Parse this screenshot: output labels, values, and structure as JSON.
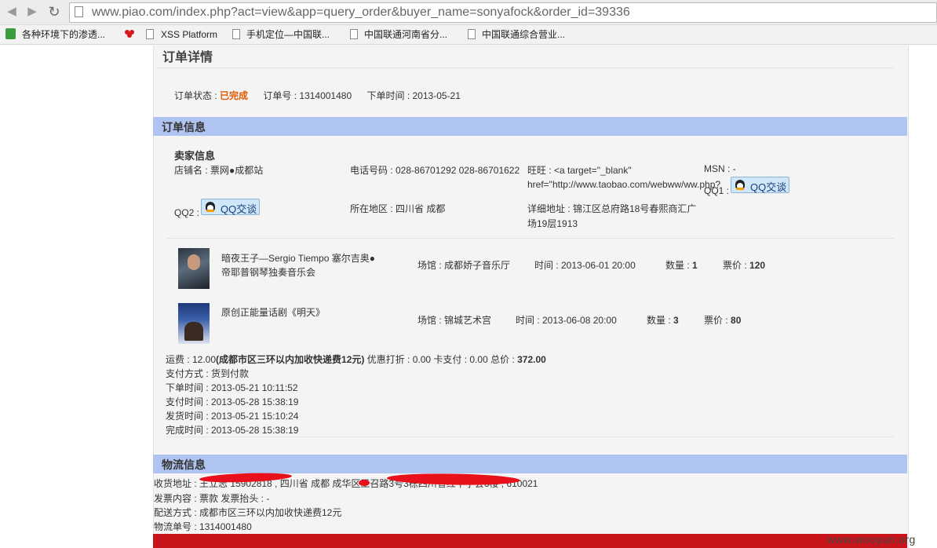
{
  "browser": {
    "url": "www.piao.com/index.php?act=view&app=query_order&buyer_name=sonyafock&order_id=39336",
    "bookmarks": [
      "各种环境下的渗透...",
      "XSS Platform",
      "手机定位—中国联...",
      "中国联通河南省分...",
      "中国联通综合营业..."
    ]
  },
  "page": {
    "title": "订单详情",
    "status_label": "订单状态 :",
    "status_value": "已完成",
    "order_no_label": "订单号 :",
    "order_no": "1314001480",
    "order_time_label": "下单时间 :",
    "order_time": "2013-05-21",
    "order_info_heading": "订单信息",
    "seller": {
      "heading": "卖家信息",
      "shop_name": "店铺名 : 票网●成都站",
      "phone": "电话号码 : 028-86701292 028-86701622",
      "wangwang_line1": "旺旺 : <a target=\"_blank\"",
      "wangwang_line2": "href=\"http://www.taobao.com/webww/ww.php?",
      "msn": "MSN : -",
      "qq1_label": "QQ1 :",
      "qq2_label": "QQ2 :",
      "qq_button": "QQ交谈",
      "region": "所在地区 : 四川省 成都",
      "address_line1": "详细地址 : 锦江区总府路18号春熙商汇广",
      "address_line2": "场19层1913"
    },
    "items": [
      {
        "name_line1": "暗夜王子—Sergio Tiempo 塞尔吉奥●",
        "name_line2": "帝耶普钢琴独奏音乐会",
        "venue": "场馆 : 成都娇子音乐厅",
        "time": "时间 :  2013-06-01 20:00",
        "qty_label": "数量 :",
        "qty": "1",
        "price_label": "票价 :",
        "price": "120"
      },
      {
        "name_line1": "原创正能量话剧《明天》",
        "name_line2": "",
        "venue": "场馆 : 锦城艺术宫",
        "time": "时间 :  2013-06-08 20:00",
        "qty_label": "数量 :",
        "qty": "3",
        "price_label": "票价 :",
        "price": "80"
      }
    ],
    "summary": {
      "freight_prefix": "运费 : 12.00",
      "freight_note": "(成都市区三环以内加收快递费12元)",
      "rest": " 优惠打折 : 0.00 卡支付 : 0.00 总价 : ",
      "total": "372.00",
      "pay_method": "支付方式 : 货到付款",
      "order_time": "下单时间 : 2013-05-21 10:11:52",
      "pay_time": "支付时间 : 2013-05-28 15:38:19",
      "ship_time": "发货时间 : 2013-05-21 15:10:24",
      "finish_time": "完成时间 : 2013-05-28 15:38:19"
    },
    "logistics": {
      "heading": "物流信息",
      "address": "收货地址 : 王立志 15902818  , 四川省 成都 成华区王召路3号3栋四川省红十字会6楼 , 610021",
      "invoice": "发票内容 : 票款 发票抬头 : -",
      "delivery": "配送方式 : 成都市区三环以内加收快递费12元",
      "tracking": "物流单号 : 1314001480"
    },
    "watermark": "www.wooyun.org"
  },
  "colors": {
    "section_header_bg": "#b0c4f1",
    "status_orange": "#e05a00",
    "redaction_red": "#e8101a",
    "footer_red": "#c8151b"
  }
}
